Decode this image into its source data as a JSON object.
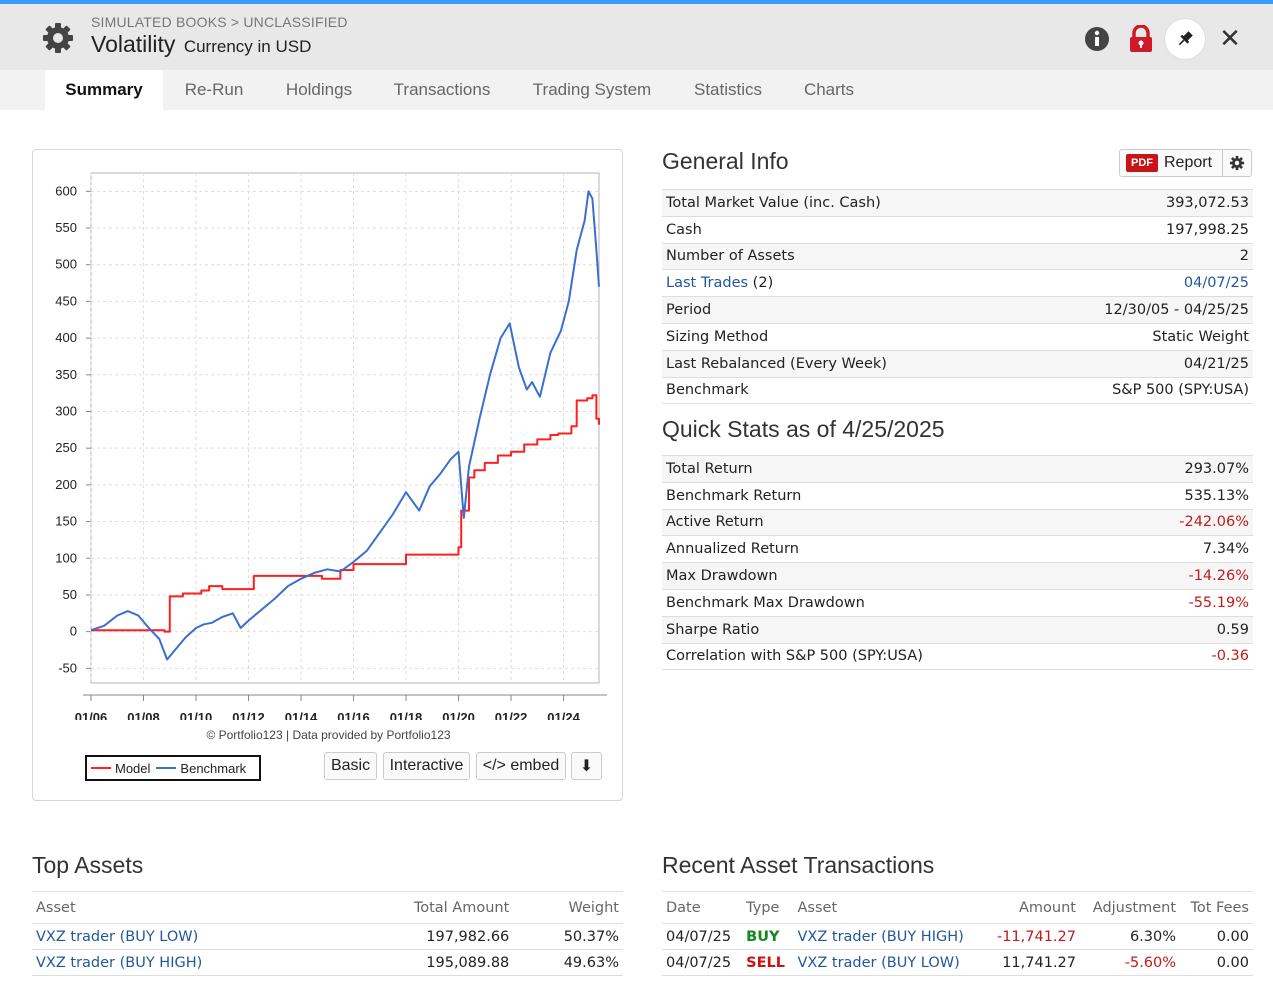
{
  "header": {
    "breadcrumb": "SIMULATED BOOKS > UNCLASSIFIED",
    "title": "Volatility",
    "currency": "Currency in USD",
    "icons": [
      "gear-icon",
      "info-icon",
      "lock-icon",
      "pin-icon",
      "close-icon"
    ],
    "close_glyph": "✕"
  },
  "tabs": [
    {
      "label": "Summary",
      "active": true
    },
    {
      "label": "Re-Run"
    },
    {
      "label": "Holdings"
    },
    {
      "label": "Transactions"
    },
    {
      "label": "Trading System"
    },
    {
      "label": "Statistics"
    },
    {
      "label": "Charts"
    }
  ],
  "chart_data": {
    "type": "line",
    "title": "",
    "xlabel": "",
    "ylabel": "",
    "xlim": [
      2006.0,
      2025.35
    ],
    "ylim": [
      -70,
      625
    ],
    "x_ticks": [
      "01/06",
      "01/08",
      "01/10",
      "01/12",
      "01/14",
      "01/16",
      "01/18",
      "01/20",
      "01/22",
      "01/24"
    ],
    "y_ticks": [
      600,
      550,
      500,
      450,
      400,
      350,
      300,
      250,
      200,
      150,
      100,
      50,
      0,
      -50
    ],
    "grid": true,
    "legend": "bottom-left",
    "series": [
      {
        "name": "Model",
        "color": "#ff1f1f",
        "step": true,
        "x": [
          2006.0,
          2008.3,
          2008.8,
          2009.0,
          2009.5,
          2010.2,
          2010.5,
          2011.0,
          2011.7,
          2012.2,
          2013.5,
          2014.8,
          2015.5,
          2016.0,
          2017.5,
          2018.0,
          2019.3,
          2020.0,
          2020.1,
          2020.4,
          2020.6,
          2021.0,
          2021.5,
          2022.0,
          2022.5,
          2023.0,
          2023.5,
          2023.8,
          2024.3,
          2024.5,
          2024.9,
          2025.1,
          2025.25,
          2025.35
        ],
        "y": [
          2,
          2,
          0,
          48,
          52,
          56,
          62,
          58,
          58,
          76,
          76,
          72,
          84,
          92,
          92,
          105,
          105,
          115,
          165,
          210,
          220,
          230,
          240,
          245,
          255,
          262,
          268,
          270,
          280,
          315,
          318,
          322,
          290,
          282
        ]
      },
      {
        "name": "Benchmark",
        "color": "#3a6fd1",
        "step": false,
        "x": [
          2006.0,
          2006.5,
          2007.0,
          2007.4,
          2007.8,
          2008.2,
          2008.6,
          2008.9,
          2009.2,
          2009.6,
          2010.0,
          2010.3,
          2010.6,
          2011.0,
          2011.4,
          2011.7,
          2012.0,
          2012.5,
          2013.0,
          2013.5,
          2014.0,
          2014.5,
          2015.0,
          2015.5,
          2016.0,
          2016.5,
          2017.0,
          2017.5,
          2018.0,
          2018.5,
          2018.9,
          2019.3,
          2019.7,
          2020.0,
          2020.2,
          2020.4,
          2020.8,
          2021.2,
          2021.6,
          2021.95,
          2022.3,
          2022.6,
          2022.8,
          2023.1,
          2023.5,
          2023.9,
          2024.2,
          2024.5,
          2024.8,
          2024.95,
          2025.1,
          2025.25,
          2025.35
        ],
        "y": [
          2,
          8,
          22,
          28,
          22,
          5,
          -10,
          -38,
          -25,
          -8,
          5,
          10,
          12,
          20,
          25,
          5,
          15,
          30,
          45,
          62,
          72,
          80,
          85,
          82,
          95,
          110,
          135,
          160,
          190,
          165,
          198,
          215,
          235,
          245,
          155,
          225,
          290,
          350,
          400,
          420,
          360,
          330,
          340,
          320,
          380,
          410,
          450,
          520,
          560,
          600,
          590,
          520,
          470
        ]
      }
    ]
  },
  "chart_footer": {
    "copyright": "© Portfolio123 | Data provided by Portfolio123",
    "legend_model": "Model",
    "legend_benchmark": "Benchmark",
    "btn_basic": "Basic",
    "btn_interactive": "Interactive",
    "btn_embed": "</> embed",
    "download_glyph": "⬇"
  },
  "general_info": {
    "title": "General Info",
    "pdf_tag": "PDF",
    "report_label": "Report",
    "rows": [
      {
        "label": "Total Market Value (inc. Cash)",
        "value": "393,072.53"
      },
      {
        "label": "Cash",
        "value": "197,998.25"
      },
      {
        "label": "Number of Assets",
        "value": "2"
      },
      {
        "label": "Last Trades",
        "label_suffix": " (2)",
        "value": "04/07/25"
      },
      {
        "label": "Period",
        "value": "12/30/05 - 04/25/25"
      },
      {
        "label": "Sizing Method",
        "value": "Static Weight"
      },
      {
        "label": "Last Rebalanced (Every Week)",
        "value": "04/21/25"
      },
      {
        "label": "Benchmark",
        "value": "S&P 500 (SPY:USA)"
      }
    ]
  },
  "quick_stats": {
    "title": "Quick Stats as of 4/25/2025",
    "rows": [
      {
        "label": "Total Return",
        "value": "293.07%"
      },
      {
        "label": "Benchmark Return",
        "value": "535.13%"
      },
      {
        "label": "Active Return",
        "value": "-242.06%"
      },
      {
        "label": "Annualized Return",
        "value": "7.34%"
      },
      {
        "label": "Max Drawdown",
        "value": "-14.26%"
      },
      {
        "label": "Benchmark Max Drawdown",
        "value": "-55.19%"
      },
      {
        "label": "Sharpe Ratio",
        "value": "0.59"
      },
      {
        "label": "Correlation with S&P 500 (SPY:USA)",
        "value": "-0.36"
      }
    ]
  },
  "top_assets": {
    "title": "Top Assets",
    "columns": [
      "Asset",
      "Total Amount",
      "Weight"
    ],
    "rows": [
      {
        "asset": "VXZ trader (BUY LOW)",
        "amount": "197,982.66",
        "weight": "50.37%"
      },
      {
        "asset": "VXZ trader (BUY HIGH)",
        "amount": "195,089.88",
        "weight": "49.63%"
      }
    ]
  },
  "recent_tx": {
    "title": "Recent Asset Transactions",
    "columns": [
      "Date",
      "Type",
      "Asset",
      "Amount",
      "Adjustment",
      "Tot Fees"
    ],
    "rows": [
      {
        "date": "04/07/25",
        "type": "BUY",
        "asset": "VXZ trader (BUY HIGH)",
        "amount": "-11,741.27",
        "adjustment": "6.30%",
        "fees": "0.00"
      },
      {
        "date": "04/07/25",
        "type": "SELL",
        "asset": "VXZ trader (BUY LOW)",
        "amount": "11,741.27",
        "adjustment": "-5.60%",
        "fees": "0.00"
      }
    ]
  }
}
